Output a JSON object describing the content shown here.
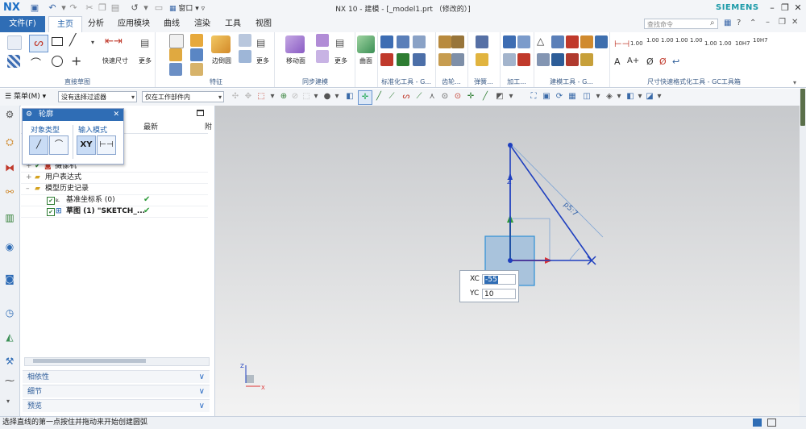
{
  "app": {
    "logo": "NX",
    "window_menu": "窗口",
    "title": "NX 10 - 建模 - [_model1.prt （修改的）]",
    "brand": "SIEMENS",
    "accent_color": "#2f6db5"
  },
  "menu": {
    "file": "文件(F)",
    "tabs": [
      "主页",
      "分析",
      "应用模块",
      "曲线",
      "渲染",
      "工具",
      "视图"
    ],
    "active_tab": "主页",
    "search_placeholder": "查找命令"
  },
  "ribbon": {
    "groups": [
      {
        "label": "直接草图",
        "items": [
          "快速尺寸",
          "更多"
        ]
      },
      {
        "label": "特征",
        "items": [
          "边倒圆",
          "更多"
        ]
      },
      {
        "label": "同步建模",
        "items": [
          "移动面",
          "更多"
        ]
      },
      {
        "label": "",
        "items": [
          "曲面"
        ]
      },
      {
        "label": "标准化工具 - G...",
        "items": []
      },
      {
        "label": "齿轮...",
        "items": []
      },
      {
        "label": "弹簧...",
        "items": []
      },
      {
        "label": "加工...",
        "items": []
      },
      {
        "label": "建模工具 - G...",
        "items": []
      },
      {
        "label": "尺寸快速格式化工具 - GC工具箱",
        "items": []
      }
    ],
    "dim_labels": [
      "1.00",
      "1.00",
      "1.00",
      "1.00",
      "1.00",
      "1.00",
      "1.00",
      "10H7",
      "10H7"
    ]
  },
  "filter_bar": {
    "menu_button": "菜单(M)",
    "type_filter": "没有选择过滤器",
    "scope_filter": "仅在工作部件内"
  },
  "navigator": {
    "columns": [
      "最新",
      "附"
    ],
    "rows": [
      {
        "label": "摄像机",
        "latest": "",
        "level": 1
      },
      {
        "label": "用户表达式",
        "latest": "",
        "level": 1
      },
      {
        "label": "模型历史记录",
        "latest": "",
        "level": 1
      },
      {
        "label": "基准坐标系 (0)",
        "latest": "✔",
        "level": 2
      },
      {
        "label": "草图 (1) \"SKETCH_...",
        "latest": "✔",
        "level": 2
      }
    ],
    "panels": [
      "相依性",
      "细节",
      "预览"
    ]
  },
  "profile_dialog": {
    "title": "轮廓",
    "object_type_label": "对象类型",
    "input_mode_label": "输入模式",
    "xy_button": "XY"
  },
  "canvas": {
    "dimension_label": "p5:7",
    "angle_label": "",
    "xc_label": "XC",
    "xc_value": "-55",
    "yc_label": "YC",
    "yc_value": "10",
    "axis_x": "X",
    "axis_z": "Z"
  },
  "statusbar": {
    "message": "选择直线的第一点按住并拖动来开始创建圆弧"
  }
}
